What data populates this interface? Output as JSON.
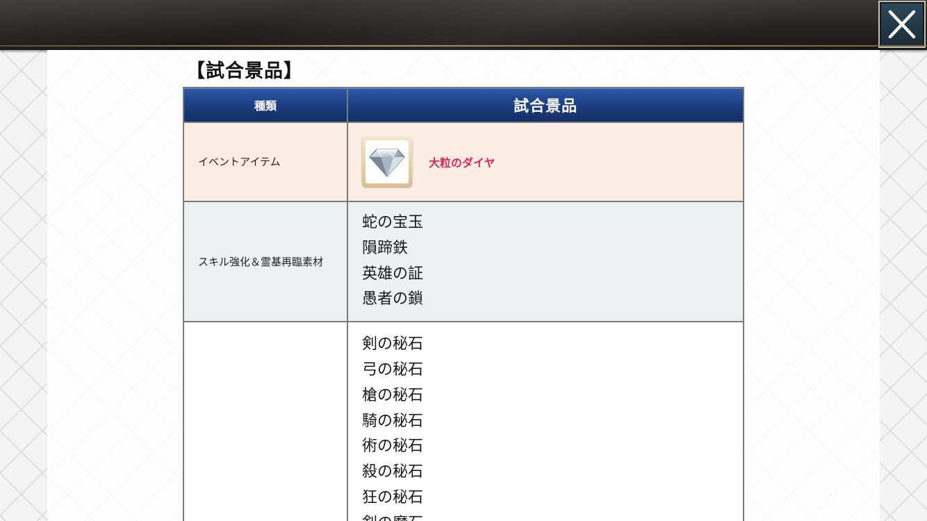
{
  "header": {
    "close_icon": "close-icon"
  },
  "section": {
    "title": "【試合景品】"
  },
  "table": {
    "headers": {
      "kind": "種類",
      "prize": "試合景品"
    },
    "rows": [
      {
        "kind": "イベントアイテム",
        "item": {
          "icon": "diamond-icon",
          "name": "大粒のダイヤ",
          "name_color": "#e5245f"
        }
      },
      {
        "kind": "スキル強化＆霊基再臨素材",
        "items": [
          "蛇の宝玉",
          "隕蹄鉄",
          "英雄の証",
          "愚者の鎖"
        ]
      },
      {
        "kind": "",
        "items": [
          "剣の秘石",
          "弓の秘石",
          "槍の秘石",
          "騎の秘石",
          "術の秘石",
          "殺の秘石",
          "狂の秘石",
          "剣の魔石"
        ]
      }
    ]
  },
  "colors": {
    "header_blue": "#1b3d80",
    "event_row_bg": "#fcede4",
    "skill_row_bg": "#edf0f1",
    "accent_pink": "#e5245f"
  }
}
